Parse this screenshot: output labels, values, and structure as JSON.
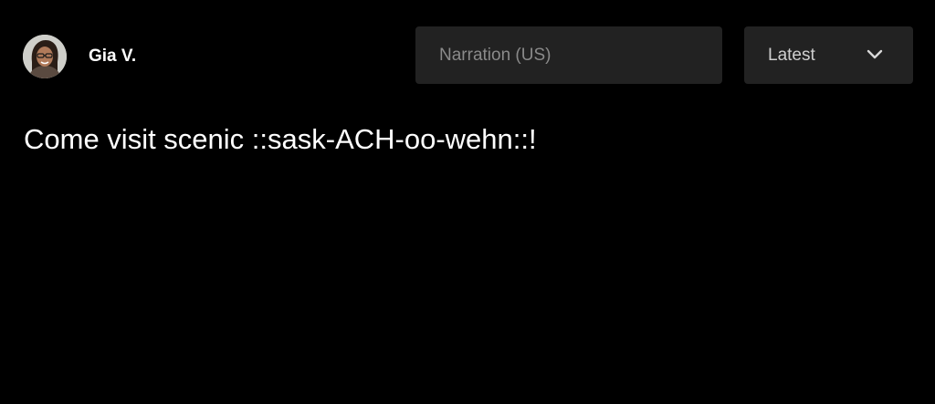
{
  "header": {
    "user_name": "Gia V.",
    "voice_selector": {
      "placeholder": "Narration (US)"
    },
    "sort_selector": {
      "selected": "Latest",
      "icon": "chevron-down-icon"
    }
  },
  "content": {
    "text": "Come visit scenic ::sask-ACH-oo-wehn::!"
  },
  "colors": {
    "background": "#000000",
    "control_background": "#222222",
    "placeholder_text": "#8a8a8a",
    "text": "#ffffff"
  }
}
